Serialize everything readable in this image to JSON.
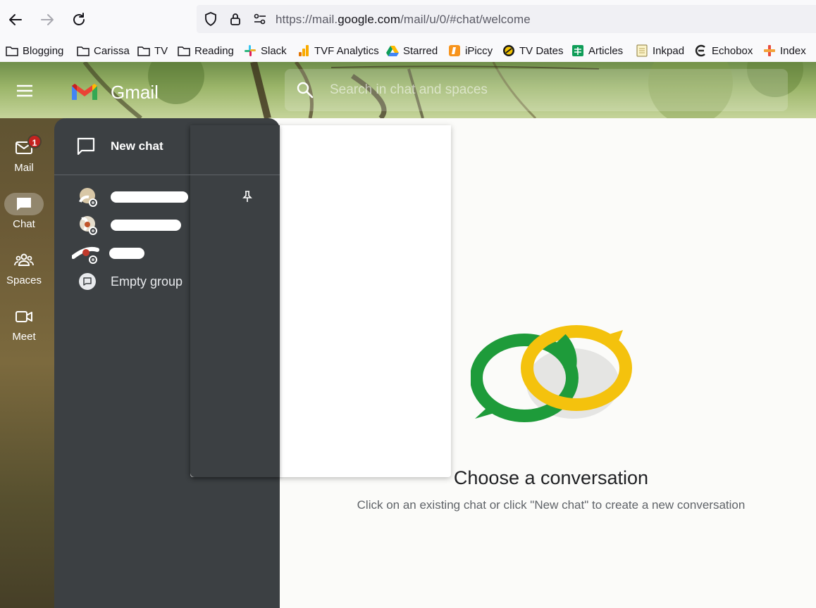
{
  "browser": {
    "url_prefix": "https://mail.",
    "url_host": "google.com",
    "url_path": "/mail/u/0/#chat/welcome",
    "bookmarks": [
      {
        "label": "Blogging",
        "icon": "folder-icon"
      },
      {
        "label": "Carissa",
        "icon": "folder-icon"
      },
      {
        "label": "TV",
        "icon": "folder-icon"
      },
      {
        "label": "Reading",
        "icon": "folder-icon"
      },
      {
        "label": "Slack",
        "icon": "slack-icon"
      },
      {
        "label": "TVF Analytics",
        "icon": "analytics-icon"
      },
      {
        "label": "Starred",
        "icon": "drive-icon"
      },
      {
        "label": "iPiccy",
        "icon": "ipiccy-icon"
      },
      {
        "label": "TV Dates",
        "icon": "tvdates-icon"
      },
      {
        "label": "Articles",
        "icon": "sheets-icon"
      },
      {
        "label": "Inkpad",
        "icon": "notepad-icon"
      },
      {
        "label": "Echobox",
        "icon": "echobox-icon"
      },
      {
        "label": "Index",
        "icon": "index-icon"
      }
    ]
  },
  "app": {
    "brand": "Gmail",
    "search_placeholder": "Search in chat and spaces",
    "rail": {
      "mail_label": "Mail",
      "mail_badge": "1",
      "chat_label": "Chat",
      "spaces_label": "Spaces",
      "meet_label": "Meet"
    },
    "drawer": {
      "new_chat_label": "New chat",
      "empty_group_label": "Empty group"
    },
    "welcome": {
      "title": "Choose a conversation",
      "subtitle": "Click on an existing chat or click \"New chat\" to create a new conversation"
    }
  },
  "colors": {
    "drawer_bg": "#3c4043",
    "mail_badge": "#c5221f",
    "chat_logo_green": "#1e9b3a",
    "chat_logo_yellow": "#f4c20d"
  }
}
